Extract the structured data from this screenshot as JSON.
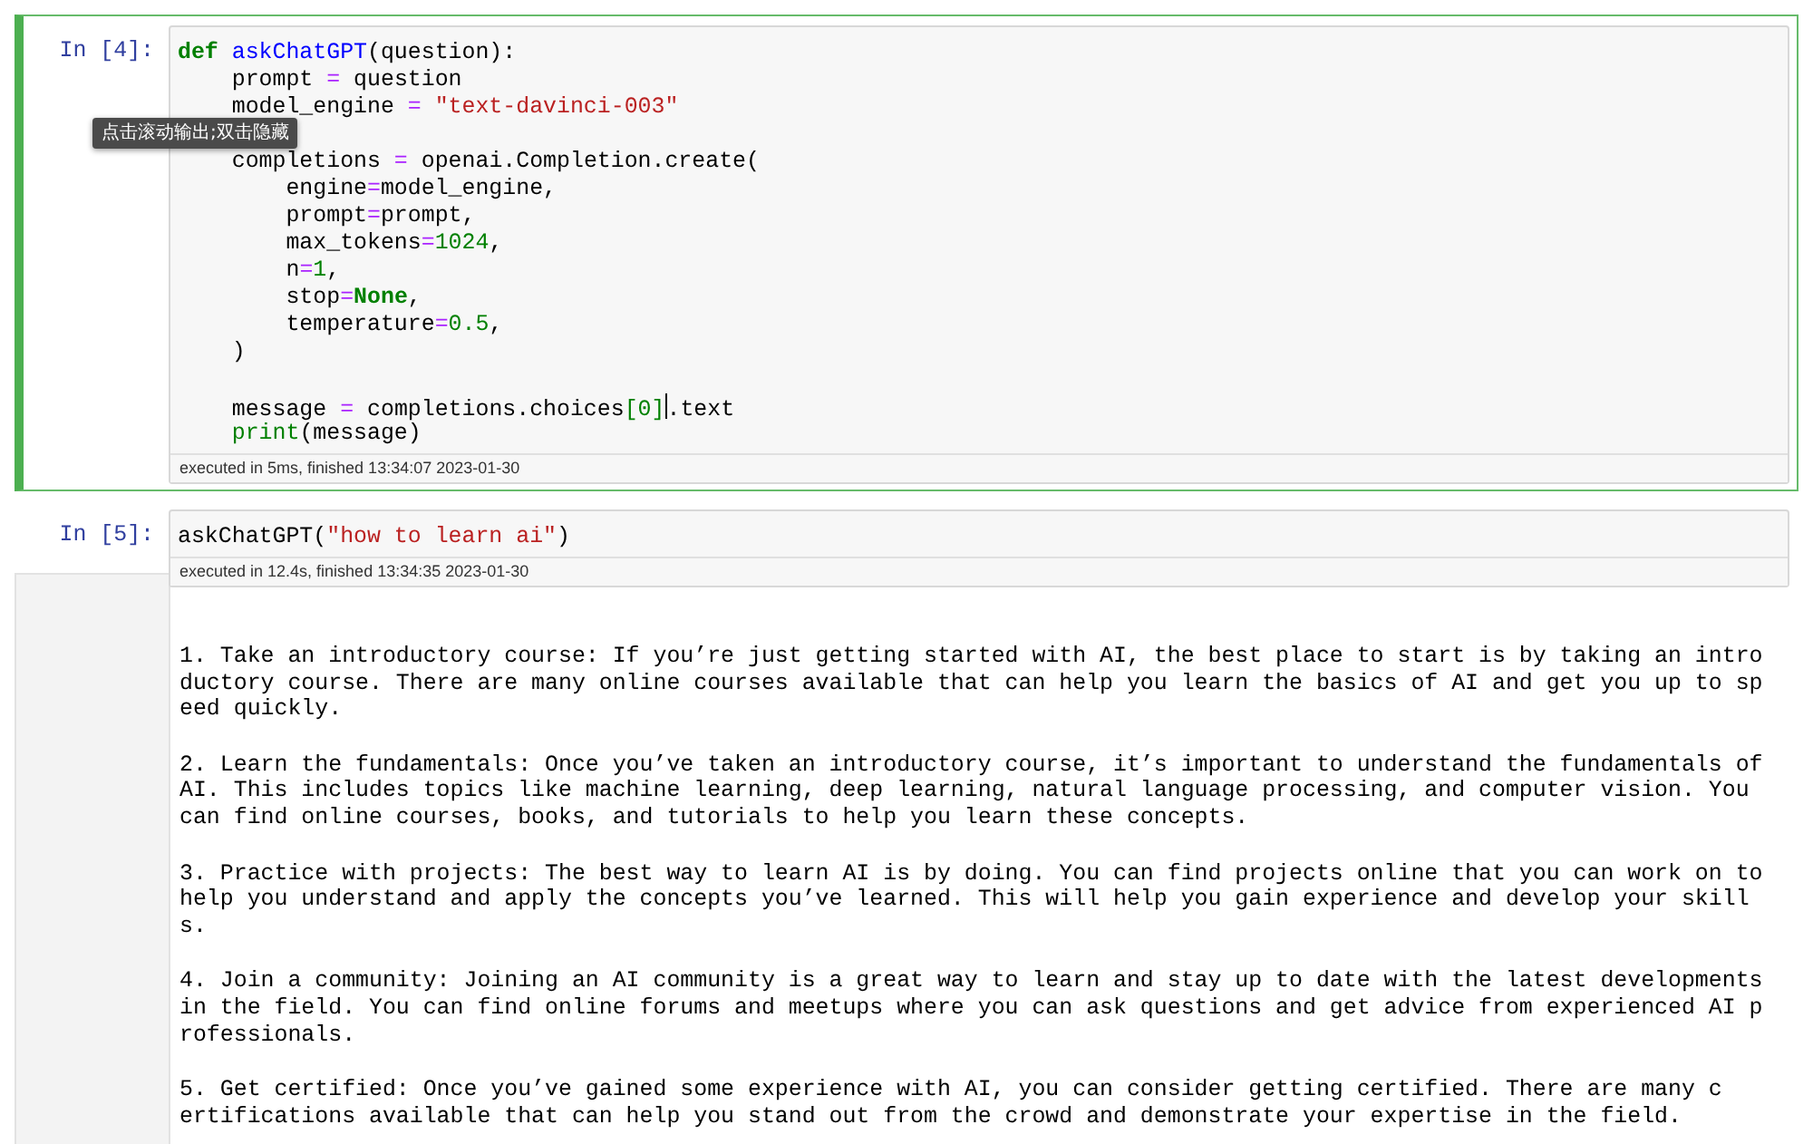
{
  "cells": [
    {
      "prompt": "In [4]:",
      "selected": true,
      "code": [
        [
          [
            {
              "kind": "keyword",
              "text": "def "
            },
            {
              "kind": "defname",
              "text": "askChatGPT"
            },
            {
              "kind": "plain",
              "text": "(question):"
            }
          ],
          [
            {
              "kind": "plain",
              "text": "    prompt"
            },
            {
              "kind": "operator",
              "text": " = "
            },
            {
              "kind": "plain",
              "text": "question"
            }
          ],
          [
            {
              "kind": "plain",
              "text": "    model_engine"
            },
            {
              "kind": "operator",
              "text": " = "
            },
            {
              "kind": "string",
              "text": "\"text-davinci-003\""
            }
          ]
        ],
        [
          [
            {
              "kind": "plain",
              "text": "    completions"
            },
            {
              "kind": "operator",
              "text": " = "
            },
            {
              "kind": "plain",
              "text": "openai.Completion.create("
            }
          ],
          [
            {
              "kind": "plain",
              "text": "        engine"
            },
            {
              "kind": "operator",
              "text": "="
            },
            {
              "kind": "plain",
              "text": "model_engine,"
            }
          ],
          [
            {
              "kind": "plain",
              "text": "        prompt"
            },
            {
              "kind": "operator",
              "text": "="
            },
            {
              "kind": "plain",
              "text": "prompt,"
            }
          ],
          [
            {
              "kind": "plain",
              "text": "        max_tokens"
            },
            {
              "kind": "operator",
              "text": "="
            },
            {
              "kind": "number",
              "text": "1024"
            },
            {
              "kind": "plain",
              "text": ","
            }
          ],
          [
            {
              "kind": "plain",
              "text": "        n"
            },
            {
              "kind": "operator",
              "text": "="
            },
            {
              "kind": "number",
              "text": "1"
            },
            {
              "kind": "plain",
              "text": ","
            }
          ],
          [
            {
              "kind": "plain",
              "text": "        stop"
            },
            {
              "kind": "operator",
              "text": "="
            },
            {
              "kind": "keyword",
              "text": "None"
            },
            {
              "kind": "plain",
              "text": ","
            }
          ],
          [
            {
              "kind": "plain",
              "text": "        temperature"
            },
            {
              "kind": "operator",
              "text": "="
            },
            {
              "kind": "number",
              "text": "0.5"
            },
            {
              "kind": "plain",
              "text": ","
            }
          ],
          [
            {
              "kind": "plain",
              "text": "    )"
            }
          ]
        ],
        [
          [
            {
              "kind": "plain",
              "text": "    message"
            },
            {
              "kind": "operator",
              "text": " = "
            },
            {
              "kind": "plain",
              "text": "completions.choices"
            },
            {
              "kind": "bracket",
              "text": "[0]"
            },
            {
              "kind": "cursor"
            },
            {
              "kind": "plain",
              "text": ".text"
            }
          ],
          [
            {
              "kind": "builtin",
              "text": "    print"
            },
            {
              "kind": "plain",
              "text": "(message)"
            }
          ]
        ]
      ],
      "footer": "executed in 5ms, finished 13:34:07 2023-01-30",
      "tooltip": "点击滚动输出;双击隐藏"
    },
    {
      "prompt": "In [5]:",
      "selected": false,
      "code": [
        [
          [
            {
              "kind": "plain",
              "text": "askChatGPT("
            },
            {
              "kind": "string",
              "text": "\"how to learn ai\""
            },
            {
              "kind": "plain",
              "text": ")"
            }
          ]
        ]
      ],
      "footer": "executed in 12.4s, finished 13:34:35 2023-01-30",
      "output": [
        [
          "1. Take an introductory course: If you’re just getting started with AI, the best place to start is by taking an intro",
          "ductory course. There are many online courses available that can help you learn the basics of AI and get you up to sp",
          "eed quickly."
        ],
        [
          "2. Learn the fundamentals: Once you’ve taken an introductory course, it’s important to understand the fundamentals of",
          "AI. This includes topics like machine learning, deep learning, natural language processing, and computer vision. You",
          "can find online courses, books, and tutorials to help you learn these concepts."
        ],
        [
          "3. Practice with projects: The best way to learn AI is by doing. You can find projects online that you can work on to",
          "help you understand and apply the concepts you’ve learned. This will help you gain experience and develop your skill",
          "s."
        ],
        [
          "4. Join a community: Joining an AI community is a great way to learn and stay up to date with the latest developments",
          "in the field. You can find online forums and meetups where you can ask questions and get advice from experienced AI p",
          "rofessionals."
        ],
        [
          "5. Get certified: Once you’ve gained some experience with AI, you can consider getting certified. There are many c",
          "ertifications available that can help you stand out from the crowd and demonstrate your expertise in the field."
        ]
      ]
    }
  ]
}
